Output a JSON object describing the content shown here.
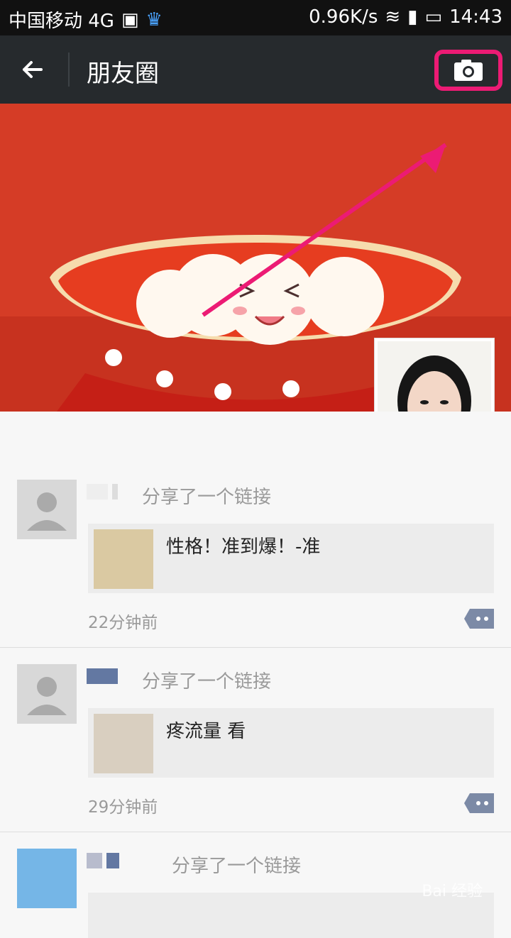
{
  "status": {
    "carrier": "中国移动 4G",
    "speed": "0.96K/s",
    "time": "14:43"
  },
  "nav": {
    "title": "朋友圈"
  },
  "posts": [
    {
      "shared": "分享了一个链接",
      "link_text": "性格！准到爆！-准",
      "time": "22分钟前"
    },
    {
      "shared": "分享了一个链接",
      "link_text": "疼流量 看",
      "time": "29分钟前"
    },
    {
      "shared": "分享了一个链接",
      "link_text": ""
    }
  ],
  "watermark": "Bai 经验"
}
